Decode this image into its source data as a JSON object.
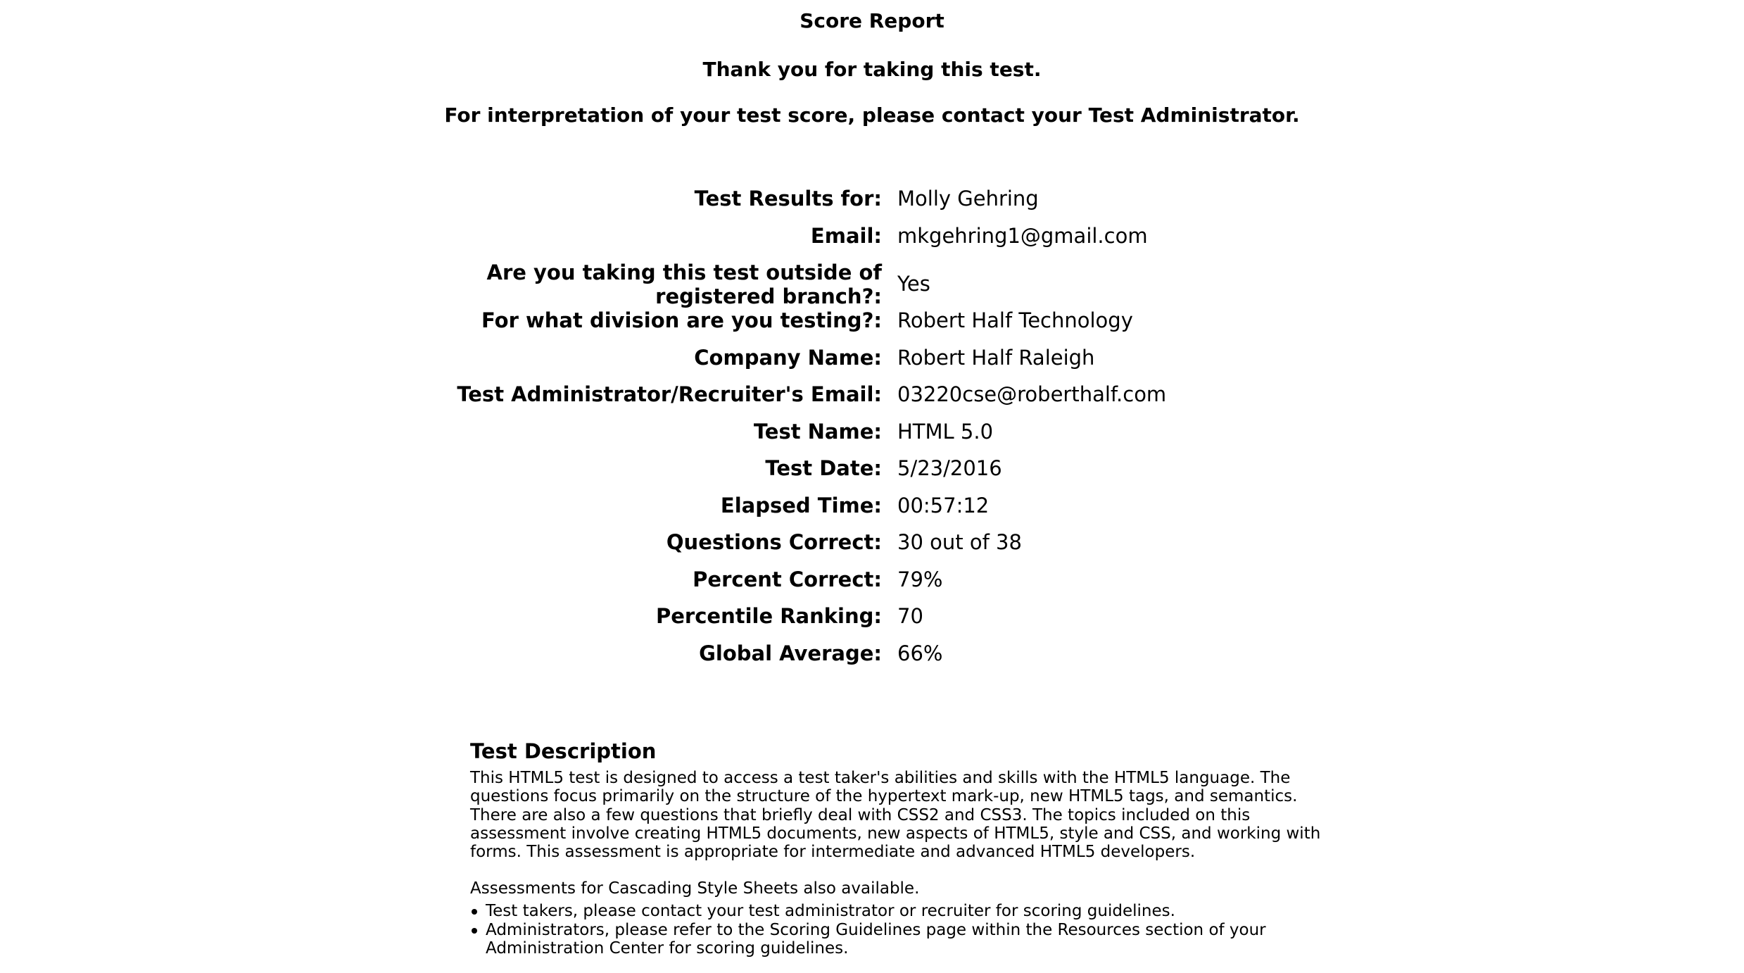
{
  "header": {
    "title": "Score Report",
    "thanks": "Thank you for taking this test.",
    "interpretation": "For interpretation of your test score, please contact your Test Administrator."
  },
  "results": [
    {
      "label": "Test Results for:",
      "value": "Molly Gehring"
    },
    {
      "label": "Email:",
      "value": "mkgehring1@gmail.com"
    },
    {
      "label": "Are you taking this test outside of registered branch?:",
      "value": "Yes"
    },
    {
      "label": "For what division are you testing?:",
      "value": "Robert Half Technology"
    },
    {
      "label": "Company Name:",
      "value": "Robert Half Raleigh"
    },
    {
      "label": "Test Administrator/Recruiter's Email:",
      "value": "03220cse@roberthalf.com"
    },
    {
      "label": "Test Name:",
      "value": "HTML 5.0"
    },
    {
      "label": "Test Date:",
      "value": "5/23/2016"
    },
    {
      "label": "Elapsed Time:",
      "value": "00:57:12"
    },
    {
      "label": "Questions Correct:",
      "value": "30 out of 38"
    },
    {
      "label": "Percent Correct:",
      "value": "79%"
    },
    {
      "label": "Percentile Ranking:",
      "value": "70"
    },
    {
      "label": "Global Average:",
      "value": "66%"
    }
  ],
  "description": {
    "title": "Test Description",
    "body": "This HTML5 test is designed to access a test taker's abilities and skills with the HTML5 language. The questions focus primarily on the structure of the hypertext mark-up, new HTML5 tags, and semantics. There are also a few questions that briefly deal with CSS2 and CSS3. The topics included on this assessment involve creating HTML5 documents, new aspects of HTML5, style and CSS, and working with forms. This assessment is appropriate for intermediate and advanced HTML5 developers.",
    "availability": "Assessments for Cascading Style Sheets also available.",
    "bullets": [
      "Test takers, please contact your test administrator or recruiter for scoring guidelines.",
      "Administrators, please refer to the Scoring Guidelines page within the Resources section of your Administration Center for scoring guidelines."
    ]
  }
}
